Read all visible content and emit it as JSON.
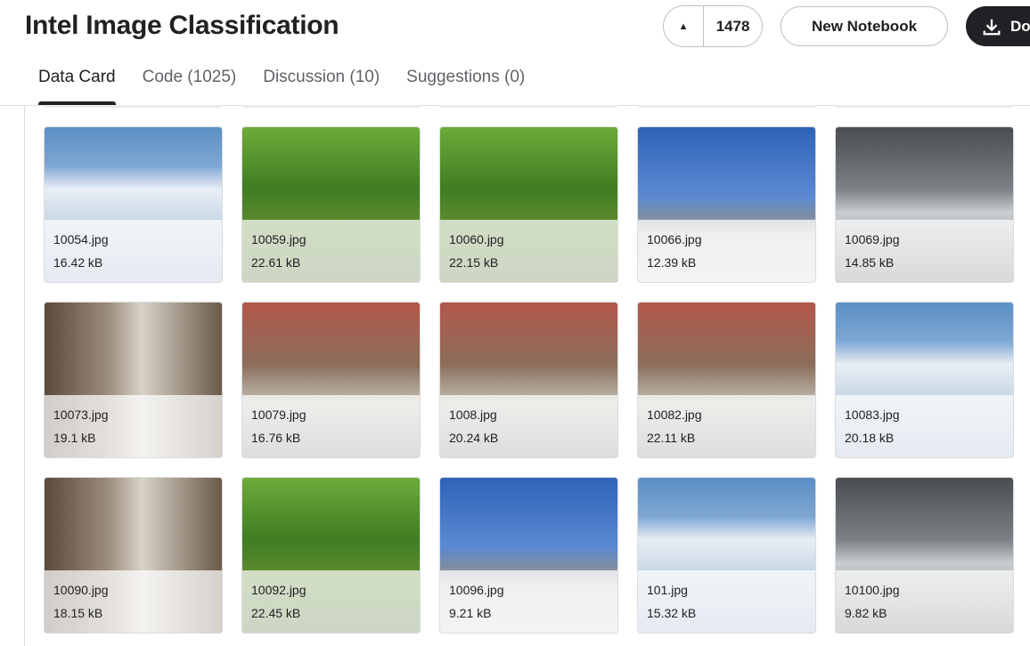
{
  "header": {
    "title": "Intel Image Classification",
    "upvote_count": "1478",
    "new_notebook": "New Notebook",
    "download": "Do"
  },
  "tabs": [
    {
      "label": "Data Card"
    },
    {
      "label": "Code (1025)"
    },
    {
      "label": "Discussion (10)"
    },
    {
      "label": "Suggestions (0)"
    }
  ],
  "files": [
    {
      "name": "10054.jpg",
      "size": "16.42 kB",
      "scene": "glacier"
    },
    {
      "name": "10059.jpg",
      "size": "22.61 kB",
      "scene": "forest"
    },
    {
      "name": "10060.jpg",
      "size": "22.15 kB",
      "scene": "forest"
    },
    {
      "name": "10066.jpg",
      "size": "12.39 kB",
      "scene": "mountain"
    },
    {
      "name": "10069.jpg",
      "size": "14.85 kB",
      "scene": "sea"
    },
    {
      "name": "10073.jpg",
      "size": "19.1 kB",
      "scene": "buildings"
    },
    {
      "name": "10079.jpg",
      "size": "16.76 kB",
      "scene": "street"
    },
    {
      "name": "1008.jpg",
      "size": "20.24 kB",
      "scene": "street"
    },
    {
      "name": "10082.jpg",
      "size": "22.11 kB",
      "scene": "street"
    },
    {
      "name": "10083.jpg",
      "size": "20.18 kB",
      "scene": "glacier"
    },
    {
      "name": "10090.jpg",
      "size": "18.15 kB",
      "scene": "buildings"
    },
    {
      "name": "10092.jpg",
      "size": "22.45 kB",
      "scene": "forest"
    },
    {
      "name": "10096.jpg",
      "size": "9.21 kB",
      "scene": "mountain"
    },
    {
      "name": "101.jpg",
      "size": "15.32 kB",
      "scene": "glacier"
    },
    {
      "name": "10100.jpg",
      "size": "9.82 kB",
      "scene": "sea"
    }
  ]
}
